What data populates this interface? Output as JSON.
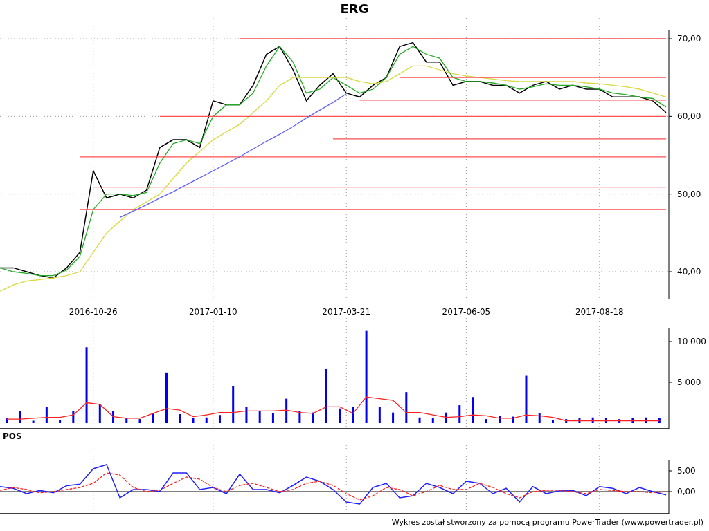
{
  "price_chart": {
    "chart_data": {
      "type": "line",
      "title": "ERG",
      "grid": true,
      "ylim": [
        36.53,
        71.07
      ],
      "categories": [
        null,
        null,
        null,
        null,
        null,
        null,
        null,
        "2016-10-26",
        null,
        null,
        null,
        null,
        null,
        null,
        null,
        null,
        "2017-01-10",
        null,
        null,
        null,
        null,
        null,
        null,
        null,
        null,
        null,
        "2017-03-21",
        null,
        null,
        null,
        null,
        null,
        null,
        null,
        null,
        "2017-06-05",
        null,
        null,
        null,
        null,
        null,
        null,
        null,
        null,
        null,
        "2017-08-18",
        null,
        null,
        null,
        null,
        null
      ],
      "yticks": [
        {
          "value": 40,
          "label": "40,00"
        },
        {
          "value": 50,
          "label": "50,00"
        },
        {
          "value": 60,
          "label": "60,00"
        },
        {
          "value": 70,
          "label": "70,00"
        }
      ],
      "series": [
        {
          "color": "#000000",
          "values": [
            40.5,
            40.5,
            40,
            39.5,
            39.2,
            40.5,
            42.5,
            53,
            49.5,
            50,
            49.5,
            50.5,
            56,
            57,
            57,
            56,
            62,
            61.5,
            61.5,
            64,
            68,
            69,
            66,
            62,
            64,
            65.5,
            63,
            62.5,
            64,
            65,
            69,
            69.5,
            67,
            67,
            64,
            64.5,
            64.5,
            64,
            64,
            63,
            64,
            64.5,
            63.5,
            64,
            63.5,
            63.5,
            62.5,
            62.5,
            62.5,
            62,
            60.5
          ]
        },
        {
          "color": "#22aa22",
          "values": [
            40.5,
            40,
            39.8,
            39.5,
            39.5,
            40.2,
            42,
            48,
            50,
            50,
            49.8,
            50.2,
            54,
            56.5,
            57,
            56.5,
            60,
            61.5,
            61.5,
            63,
            66.5,
            69,
            67,
            63,
            63.5,
            65,
            64,
            63,
            63.5,
            65,
            68,
            69,
            68,
            67.5,
            65,
            64.5,
            64.5,
            64.3,
            64,
            63.5,
            63.8,
            64.2,
            64,
            64,
            63.8,
            63.5,
            63,
            62.8,
            62.5,
            62.3,
            61.2
          ]
        },
        {
          "color": "#d8d840",
          "values": [
            37.5,
            38.3,
            38.8,
            39,
            39.2,
            39.5,
            40,
            42.5,
            45,
            46.5,
            48,
            49,
            50,
            52,
            54,
            55.5,
            57,
            58,
            59,
            60.5,
            62,
            64,
            65,
            65,
            65,
            65,
            65,
            64.5,
            64.2,
            64.5,
            65.5,
            66.5,
            66.5,
            66,
            65.5,
            65.2,
            65,
            64.8,
            64.6,
            64.5,
            64.5,
            64.5,
            64.5,
            64.5,
            64.3,
            64.2,
            64,
            63.8,
            63.5,
            63,
            62.5
          ]
        },
        {
          "color": "#ff5050",
          "values": [
            null,
            null,
            null,
            null,
            null,
            null,
            null,
            null,
            null,
            null,
            null,
            null,
            null,
            null,
            null,
            null,
            null,
            null,
            70,
            70,
            70,
            70,
            70,
            70,
            70,
            70,
            70,
            70,
            70,
            70,
            70,
            70,
            70,
            70,
            70,
            70,
            70,
            70,
            70,
            70,
            70,
            70,
            70,
            70,
            70,
            70,
            70,
            70,
            70,
            70,
            70
          ]
        },
        {
          "color": "#ff5050",
          "values": [
            null,
            null,
            null,
            null,
            null,
            null,
            null,
            null,
            null,
            null,
            null,
            null,
            null,
            null,
            null,
            null,
            null,
            null,
            null,
            null,
            null,
            null,
            null,
            null,
            null,
            null,
            null,
            null,
            null,
            null,
            65,
            65,
            65,
            65,
            65,
            65,
            65,
            65,
            65,
            65,
            65,
            65,
            65,
            65,
            65,
            65,
            65,
            65,
            65,
            65,
            65
          ]
        },
        {
          "color": "#ff5050",
          "values": [
            null,
            null,
            null,
            null,
            null,
            null,
            null,
            null,
            null,
            null,
            null,
            null,
            null,
            null,
            null,
            null,
            null,
            null,
            null,
            null,
            null,
            null,
            null,
            null,
            null,
            null,
            null,
            62.1,
            62.1,
            62.1,
            62.1,
            62.1,
            62.1,
            62.1,
            62.1,
            62.1,
            62.1,
            62.1,
            62.1,
            62.1,
            62.1,
            62.1,
            62.1,
            62.1,
            62.1,
            62.1,
            62.1,
            62.1,
            62.1,
            62.1,
            62.1
          ]
        },
        {
          "color": "#ff5050",
          "values": [
            null,
            null,
            null,
            null,
            null,
            null,
            null,
            null,
            null,
            null,
            null,
            null,
            60,
            60,
            60,
            60,
            60,
            60,
            60,
            60,
            60,
            60,
            60,
            60,
            60,
            60,
            60,
            60,
            60,
            60,
            60,
            60,
            60,
            60,
            60,
            60,
            60,
            60,
            60,
            60,
            60,
            60,
            60,
            60,
            60,
            60,
            60,
            60,
            60,
            60,
            60
          ]
        },
        {
          "color": "#ff5050",
          "values": [
            null,
            null,
            null,
            null,
            null,
            null,
            null,
            null,
            null,
            null,
            null,
            null,
            null,
            null,
            null,
            null,
            null,
            null,
            null,
            null,
            null,
            null,
            null,
            null,
            null,
            57.1,
            57.1,
            57.1,
            57.1,
            57.1,
            57.1,
            57.1,
            57.1,
            57.1,
            57.1,
            57.1,
            57.1,
            57.1,
            57.1,
            57.1,
            57.1,
            57.1,
            57.1,
            57.1,
            57.1,
            57.1,
            57.1,
            57.1,
            57.1,
            57.1,
            57.1
          ]
        },
        {
          "color": "#ff5050",
          "values": [
            null,
            null,
            null,
            null,
            null,
            null,
            54.8,
            54.8,
            54.8,
            54.8,
            54.8,
            54.8,
            54.8,
            54.8,
            54.8,
            54.8,
            54.8,
            54.8,
            54.8,
            54.8,
            54.8,
            54.8,
            54.8,
            54.8,
            54.8,
            54.8,
            54.8,
            54.8,
            54.8,
            54.8,
            54.8,
            54.8,
            54.8,
            54.8,
            54.8,
            54.8,
            54.8,
            54.8,
            54.8,
            54.8,
            54.8,
            54.8,
            54.8,
            54.8,
            54.8,
            54.8,
            54.8,
            54.8,
            54.8,
            54.8,
            54.8
          ]
        },
        {
          "color": "#ff5050",
          "values": [
            null,
            null,
            null,
            null,
            null,
            null,
            null,
            50.9,
            50.9,
            50.9,
            50.9,
            50.9,
            50.9,
            50.9,
            50.9,
            50.9,
            50.9,
            50.9,
            50.9,
            50.9,
            50.9,
            50.9,
            50.9,
            50.9,
            50.9,
            50.9,
            50.9,
            50.9,
            50.9,
            50.9,
            50.9,
            50.9,
            50.9,
            50.9,
            50.9,
            50.9,
            50.9,
            50.9,
            50.9,
            50.9,
            50.9,
            50.9,
            50.9,
            50.9,
            50.9,
            50.9,
            50.9,
            50.9,
            50.9,
            50.9,
            50.9
          ]
        },
        {
          "color": "#ff5050",
          "values": [
            null,
            null,
            null,
            null,
            null,
            null,
            48,
            48,
            48,
            48,
            48,
            48,
            48,
            48,
            48,
            48,
            48,
            48,
            48,
            48,
            48,
            48,
            48,
            48,
            48,
            48,
            48,
            48,
            48,
            48,
            48,
            48,
            48,
            48,
            48,
            48,
            48,
            48,
            48,
            48,
            48,
            48,
            48,
            48,
            48,
            48,
            48,
            48,
            48,
            48,
            48
          ]
        },
        {
          "color": "#6060ff",
          "values": [
            null,
            null,
            null,
            null,
            null,
            null,
            null,
            null,
            null,
            47,
            47.8,
            48.6,
            49.5,
            50.3,
            51.2,
            52.1,
            53,
            53.9,
            54.8,
            55.8,
            56.8,
            57.7,
            58.7,
            59.8,
            60.8,
            61.8,
            62.9,
            null,
            null,
            null,
            null,
            null,
            null,
            null,
            null,
            null,
            null,
            null,
            null,
            null,
            null,
            null,
            null,
            null,
            null,
            null,
            null,
            null,
            null,
            null,
            null
          ]
        }
      ]
    }
  },
  "volume_chart": {
    "chart_data": {
      "type": "bar",
      "grid": true,
      "ylim": [
        0,
        11695
      ],
      "yticks": [
        {
          "value": 5000,
          "label": "5 000"
        },
        {
          "value": 10000,
          "label": "10 000"
        }
      ],
      "categories": [
        null,
        null,
        null,
        null,
        null,
        null,
        null,
        null,
        null,
        null,
        null,
        null,
        null,
        null,
        null,
        null,
        null,
        null,
        null,
        null,
        null,
        null,
        null,
        null,
        null,
        null,
        null,
        null,
        null,
        null,
        null,
        null,
        null,
        null,
        null,
        null,
        null,
        null,
        null,
        null,
        null,
        null,
        null,
        null,
        null,
        null,
        null,
        null,
        null,
        null
      ],
      "series": [
        {
          "color": "#0000ee",
          "values": [
            600,
            1500,
            300,
            2000,
            400,
            1500,
            9300,
            2300,
            1500,
            600,
            500,
            1200,
            6200,
            1100,
            600,
            700,
            1000,
            4500,
            2000,
            1500,
            1200,
            3000,
            1500,
            1300,
            6700,
            1800,
            2000,
            11300,
            2000,
            1300,
            3800,
            700,
            600,
            1300,
            2200,
            3200,
            500,
            900,
            800,
            5800,
            1200,
            400,
            500,
            600,
            700,
            600,
            500,
            600,
            700,
            600
          ]
        },
        {
          "type": "line",
          "color": "#ff2020",
          "values": [
            500,
            500,
            600,
            700,
            700,
            1000,
            2500,
            2300,
            800,
            600,
            600,
            1200,
            1800,
            1600,
            800,
            1000,
            1300,
            1300,
            1500,
            1500,
            1500,
            1600,
            1300,
            1200,
            2000,
            2000,
            1200,
            3200,
            3000,
            2800,
            1300,
            1300,
            1000,
            700,
            800,
            1000,
            900,
            600,
            600,
            1000,
            900,
            700,
            300,
            300,
            300,
            300,
            300,
            300,
            300,
            300
          ]
        }
      ]
    }
  },
  "pos_chart": {
    "chart_data": {
      "type": "line",
      "title": "POS",
      "grid": true,
      "ylim": [
        -5.33,
        7.5
      ],
      "yticks": [
        {
          "value": 0,
          "label": "0,00"
        },
        {
          "value": 5,
          "label": "5,00"
        }
      ],
      "categories": [
        null,
        null,
        null,
        null,
        null,
        null,
        null,
        null,
        null,
        null,
        null,
        null,
        null,
        null,
        null,
        null,
        null,
        null,
        null,
        null,
        null,
        null,
        null,
        null,
        null,
        null,
        null,
        null,
        null,
        null,
        null,
        null,
        null,
        null,
        null,
        null,
        null,
        null,
        null,
        null,
        null,
        null,
        null,
        null,
        null,
        null,
        null,
        null,
        null,
        null,
        null
      ],
      "series": [
        {
          "color": "#2020ff",
          "values": [
            1.2,
            0.8,
            -0.5,
            0.3,
            -0.3,
            1.4,
            1.8,
            5.5,
            6.5,
            -1.5,
            0.5,
            0.5,
            0,
            4.5,
            4.5,
            0.5,
            1,
            -0.5,
            4.2,
            0.5,
            0.5,
            -0.3,
            1.5,
            3.5,
            2.5,
            0.5,
            -2.5,
            -3,
            1,
            2,
            -1.5,
            -1,
            2,
            1,
            -0.5,
            2.5,
            2,
            -0.5,
            0.8,
            -2.5,
            1.2,
            -0.5,
            0.2,
            0.3,
            -1,
            1.2,
            0.8,
            -0.5,
            1,
            0,
            -0.8
          ]
        },
        {
          "color": "#ff2020",
          "line_style": "dashed",
          "values": [
            0.3,
            1,
            0.5,
            -0.3,
            0,
            0.5,
            1,
            2,
            4.5,
            4,
            1,
            0,
            0.3,
            2,
            3.5,
            3,
            1,
            0,
            1.5,
            2,
            1,
            0,
            0.5,
            2,
            2.5,
            1.5,
            -0.5,
            -2,
            -1,
            1,
            0.5,
            -1,
            0,
            1.5,
            0.5,
            0.5,
            2,
            1,
            -0.5,
            -1.5,
            0,
            0.3,
            0.3,
            0,
            -0.5,
            0.5,
            0.3,
            0,
            0,
            -0.3,
            0
          ]
        }
      ]
    }
  },
  "footer": "Wykres został stworzony za pomocą programu PowerTrader (www.powertrader.pl)"
}
